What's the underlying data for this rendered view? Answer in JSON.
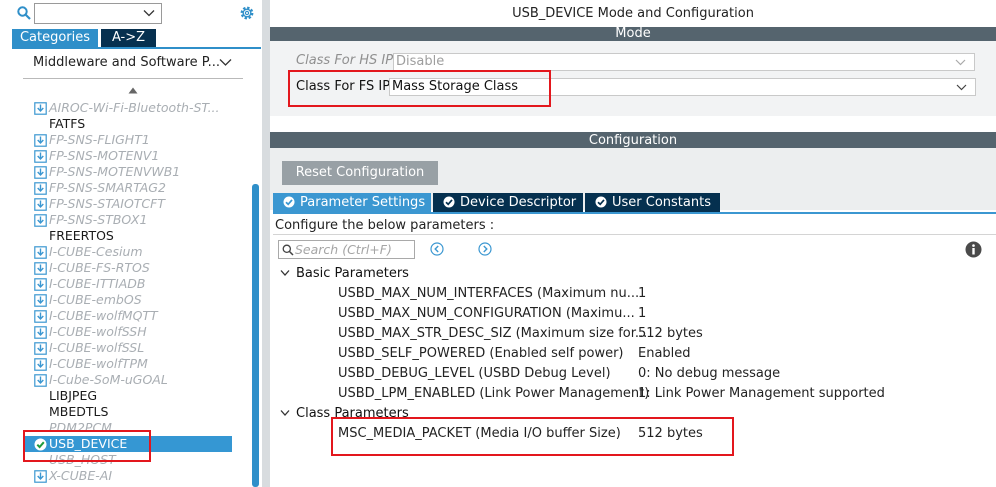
{
  "left_panel": {
    "search": {
      "value": "",
      "placeholder": ""
    },
    "tabs": {
      "categories": "Categories",
      "atoz": "A->Z"
    },
    "category": "Middleware and Software P...",
    "items": [
      {
        "label": "AIROC-Wi-Fi-Bluetooth-ST...",
        "style": "dim",
        "icon": "download-icon"
      },
      {
        "label": "FATFS",
        "style": "plain",
        "icon": ""
      },
      {
        "label": "FP-SNS-FLIGHT1",
        "style": "dim",
        "icon": "download-icon"
      },
      {
        "label": "FP-SNS-MOTENV1",
        "style": "dim",
        "icon": "download-icon"
      },
      {
        "label": "FP-SNS-MOTENVWB1",
        "style": "dim",
        "icon": "download-icon"
      },
      {
        "label": "FP-SNS-SMARTAG2",
        "style": "dim",
        "icon": "download-icon"
      },
      {
        "label": "FP-SNS-STAIOTCFT",
        "style": "dim",
        "icon": "download-icon"
      },
      {
        "label": "FP-SNS-STBOX1",
        "style": "dim",
        "icon": "download-icon"
      },
      {
        "label": "FREERTOS",
        "style": "plain",
        "icon": ""
      },
      {
        "label": "I-CUBE-Cesium",
        "style": "dim",
        "icon": "download-icon"
      },
      {
        "label": "I-CUBE-FS-RTOS",
        "style": "dim",
        "icon": "download-icon"
      },
      {
        "label": "I-CUBE-ITTIADB",
        "style": "dim",
        "icon": "download-icon"
      },
      {
        "label": "I-CUBE-embOS",
        "style": "dim",
        "icon": "download-icon"
      },
      {
        "label": "I-CUBE-wolfMQTT",
        "style": "dim",
        "icon": "download-icon"
      },
      {
        "label": "I-CUBE-wolfSSH",
        "style": "dim",
        "icon": "download-icon"
      },
      {
        "label": "I-CUBE-wolfSSL",
        "style": "dim",
        "icon": "download-icon"
      },
      {
        "label": "I-CUBE-wolfTPM",
        "style": "dim",
        "icon": "download-icon"
      },
      {
        "label": "I-Cube-SoM-uGOAL",
        "style": "dim",
        "icon": "download-icon"
      },
      {
        "label": "LIBJPEG",
        "style": "plain",
        "icon": ""
      },
      {
        "label": "MBEDTLS",
        "style": "plain",
        "icon": ""
      },
      {
        "label": "PDM2PCM",
        "style": "dim",
        "icon": ""
      },
      {
        "label": "USB_DEVICE",
        "style": "selected",
        "icon": "check-circle-icon"
      },
      {
        "label": "USB_HOST",
        "style": "dim",
        "icon": ""
      },
      {
        "label": "X-CUBE-AI",
        "style": "dim",
        "icon": "download-icon"
      }
    ]
  },
  "main": {
    "title": "USB_DEVICE Mode and Configuration",
    "mode_header": "Mode",
    "class_hs": {
      "label": "Class For HS IP",
      "value": "Disable"
    },
    "class_fs": {
      "label": "Class For FS IP",
      "value": "Mass Storage Class"
    },
    "config_header": "Configuration",
    "reset_button": "Reset Configuration",
    "tabs": [
      "Parameter Settings",
      "Device Descriptor",
      "User Constants"
    ],
    "configure_label": "Configure the below parameters :",
    "search_placeholder": "Search (Ctrl+F)",
    "groups": [
      {
        "name": "Basic Parameters",
        "params": [
          {
            "name": "USBD_MAX_NUM_INTERFACES (Maximum nu...",
            "value": "1"
          },
          {
            "name": "USBD_MAX_NUM_CONFIGURATION (Maximu...",
            "value": "1"
          },
          {
            "name": "USBD_MAX_STR_DESC_SIZ (Maximum size for...",
            "value": "512 bytes"
          },
          {
            "name": "USBD_SELF_POWERED (Enabled self power)",
            "value": "Enabled"
          },
          {
            "name": "USBD_DEBUG_LEVEL (USBD Debug Level)",
            "value": "0: No debug message"
          },
          {
            "name": "USBD_LPM_ENABLED (Link Power Management)",
            "value": "1: Link Power Management supported"
          }
        ]
      },
      {
        "name": "Class Parameters",
        "params": [
          {
            "name": "MSC_MEDIA_PACKET (Media I/O buffer Size)",
            "value": "512 bytes"
          }
        ]
      }
    ]
  },
  "colors": {
    "accent": "#2f8fc9",
    "dark_tab": "#05304f",
    "section_bar": "#55646e",
    "highlight_box": "#e3171d",
    "disabled_text": "#a9aeb3"
  }
}
